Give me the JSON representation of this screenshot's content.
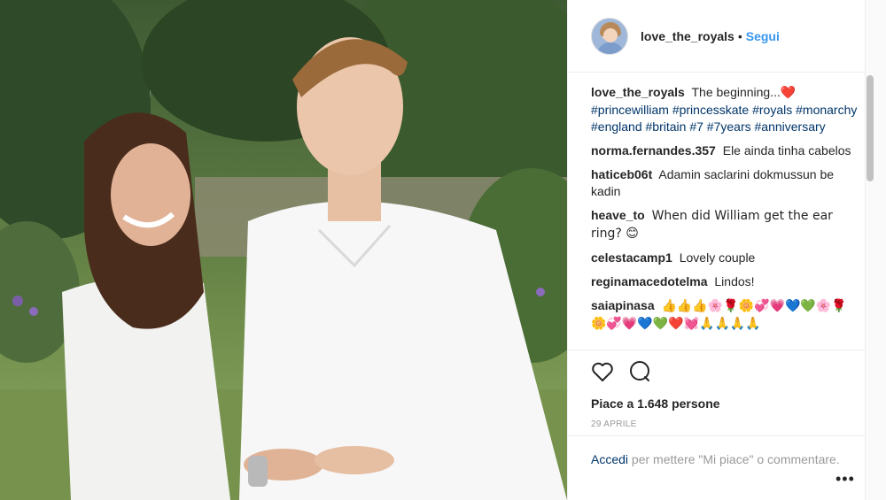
{
  "post": {
    "username": "love_the_royals",
    "separator": "•",
    "follow_label": "Segui",
    "caption": {
      "username": "love_the_royals",
      "text": "The beginning...",
      "heart_emoji": "❤️",
      "hashtags": [
        "#princewilliam",
        "#princesskate",
        "#royals",
        "#monarchy",
        "#england",
        "#britain",
        "#7",
        "#7years",
        "#anniversary"
      ]
    },
    "comments": [
      {
        "user": "norma.fernandes.357",
        "text": "Ele ainda tinha cabelos"
      },
      {
        "user": "haticeb06t",
        "text": "Adamin saclarini dokmussun be kadin"
      },
      {
        "user": "heave_to",
        "text": "When did William get the ear ring? 😊"
      },
      {
        "user": "celestacamp1",
        "text": "Lovely couple"
      },
      {
        "user": "reginamacedotelma",
        "text": "Lindos!"
      },
      {
        "user": "saiapinasa",
        "text": "👍👍👍🌸🌹🌼💞💗💙💚🌸🌹🌼💞💗💙💚❤️💓🙏🙏🙏🙏"
      }
    ],
    "likes_label": "Piace a 1.648 persone",
    "date": "29 APRILE",
    "login": {
      "link": "Accedi",
      "text": "per mettere \"Mi piace\" o commentare.",
      "more": "•••"
    },
    "icons": {
      "like": "heart-icon",
      "comment": "comment-icon"
    }
  }
}
